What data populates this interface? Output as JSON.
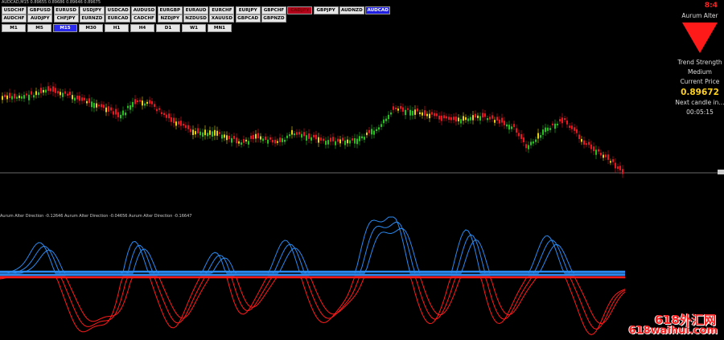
{
  "title": "AUDCAD,M15 0.89655 0.89686 0.89646 0.89675",
  "symbols_row1": [
    "USDCHF",
    "GBPUSD",
    "EURUSD",
    "USDJPY",
    "USDCAD",
    "AUDUSD",
    "EURGBP",
    "EURAUD",
    "EURCHF",
    "EURJPY",
    "GBPCHF",
    "CADJPY",
    "GBPJPY",
    "AUDNZD",
    "AUDCAD"
  ],
  "symbols_row2": [
    "AUDCHF",
    "AUDJPY",
    "CHFJPY",
    "EURNZD",
    "EURCAD",
    "CADCHF",
    "NZDJPY",
    "NZDUSD",
    "XAUUSD",
    "GBPCAD",
    "GBPNZD"
  ],
  "symbol_states": {
    "CADJPY": "red",
    "AUDCAD": "blue"
  },
  "timeframes": [
    "M1",
    "M5",
    "M15",
    "M30",
    "H1",
    "H4",
    "D1",
    "W1",
    "MN1"
  ],
  "selected_timeframe": "M15",
  "clock": "8:4",
  "panel": {
    "name": "Aurum Alter",
    "trend_label": "Trend Strength",
    "trend_value": "Medium",
    "price_label": "Current Price",
    "price": "0.89672",
    "next_candle_label": "Next candle in...",
    "countdown": "00:05:15"
  },
  "indicator_title": "Aurum Alter Direction -0.12646  Aurum Alter Direction -0.04656  Aurum Alter Direction -0.16647",
  "watermark": {
    "line1": "618外汇网",
    "line2": "618waihui.com"
  },
  "colors": {
    "bull": "#22c41c",
    "bear": "#e8141e",
    "neutral": "#e8d20f",
    "indicator_blue": "#2a8af0",
    "indicator_red": "#ff1a1a",
    "arrow": "#ff1a1a",
    "price_text": "#ffd21a"
  },
  "icons": {
    "trend_arrow": "down-triangle-icon"
  }
}
